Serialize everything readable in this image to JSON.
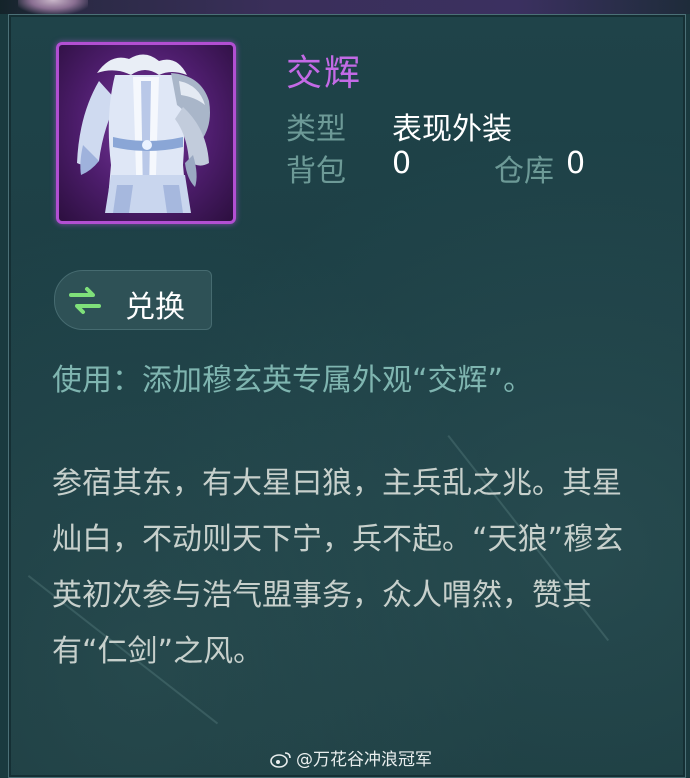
{
  "item": {
    "name": "交辉",
    "type_label": "类型",
    "type_value": "表现外装",
    "bag_label": "背包",
    "bag_count": "0",
    "warehouse_label": "仓库",
    "warehouse_count": "0",
    "icon": "outfit-armor-icon"
  },
  "exchange": {
    "label": "兑换",
    "icon": "exchange-arrows-icon"
  },
  "usage_text": "使用：添加穆玄英专属外观“交辉”。",
  "description": "参宿其东，有大星曰狼，主兵乱之兆。其星灿白，不动则天下宁，兵不起。“天狼”穆玄英初次参与浩气盟事务，众人喟然，赞其有“仁剑”之风。",
  "watermark": "@万花谷冲浪冠军",
  "colors": {
    "title": "#c36ae6",
    "label": "#6d9a97",
    "usage": "#7fb5b0",
    "panel": "#1f4349"
  }
}
